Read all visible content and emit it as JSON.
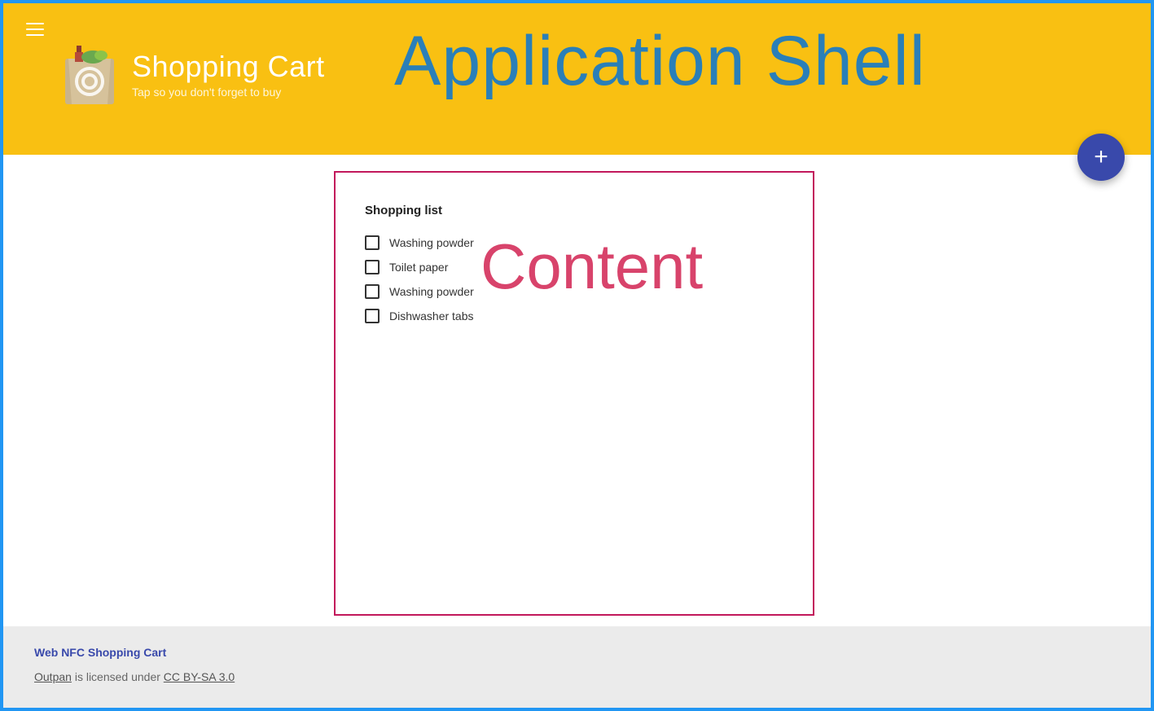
{
  "header": {
    "title": "Shopping Cart",
    "subtitle": "Tap so you don't forget to buy"
  },
  "overlays": {
    "shell": "Application Shell",
    "content": "Content"
  },
  "list": {
    "title": "Shopping list",
    "items": [
      {
        "label": "Washing powder"
      },
      {
        "label": "Toilet paper"
      },
      {
        "label": "Washing powder"
      },
      {
        "label": "Dishwasher tabs"
      }
    ]
  },
  "fab": {
    "symbol": "+"
  },
  "footer": {
    "title": "Web NFC Shopping Cart",
    "link1": "Outpan",
    "mid": " is licensed under ",
    "link2": "CC BY-SA 3.0"
  }
}
